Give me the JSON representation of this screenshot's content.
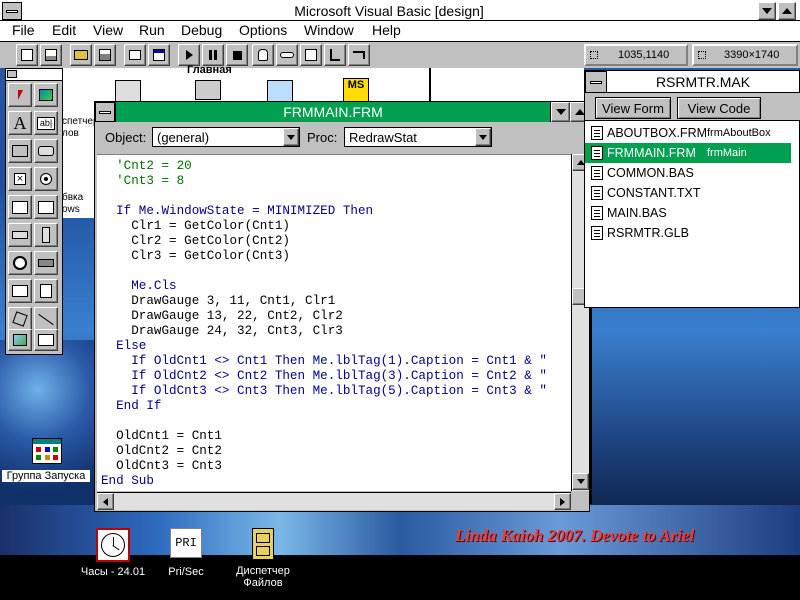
{
  "main_window": {
    "title": "Microsoft Visual Basic [design]",
    "menu": [
      "File",
      "Edit",
      "View",
      "Run",
      "Debug",
      "Options",
      "Window",
      "Help"
    ],
    "position_readout": "1035,1140",
    "size_readout": "3390×1740"
  },
  "code_window": {
    "title": "FRMMAIN.FRM",
    "object_label": "Object:",
    "object_value": "(general)",
    "proc_label": "Proc:",
    "proc_value": "RedrawStat",
    "lines": [
      "  'Cnt2 = 20",
      "  'Cnt3 = 8",
      "",
      "  If Me.WindowState = MINIMIZED Then",
      "    Clr1 = GetColor(Cnt1)",
      "    Clr2 = GetColor(Cnt2)",
      "    Clr3 = GetColor(Cnt3)",
      "",
      "    Me.Cls",
      "    DrawGauge 3, 11, Cnt1, Clr1",
      "    DrawGauge 13, 22, Cnt2, Clr2",
      "    DrawGauge 24, 32, Cnt3, Clr3",
      "  Else",
      "    If OldCnt1 <> Cnt1 Then Me.lblTag(1).Caption = Cnt1 & \"",
      "    If OldCnt2 <> Cnt2 Then Me.lblTag(3).Caption = Cnt2 & \"",
      "    If OldCnt3 <> Cnt3 Then Me.lblTag(5).Caption = Cnt3 & \"",
      "  End If",
      "",
      "  OldCnt1 = Cnt1",
      "  OldCnt2 = Cnt2",
      "  OldCnt3 = Cnt3",
      "End Sub"
    ]
  },
  "project_window": {
    "title": "RSRMTR.MAK",
    "view_form_label": "View Form",
    "view_code_label": "View Code",
    "files": [
      {
        "name": "ABOUTBOX.FRM",
        "module": "frmAboutBox",
        "selected": false
      },
      {
        "name": "FRMMAIN.FRM",
        "module": "frmMain",
        "selected": true
      },
      {
        "name": "COMMON.BAS",
        "module": "",
        "selected": false
      },
      {
        "name": "CONSTANT.TXT",
        "module": "",
        "selected": false
      },
      {
        "name": "MAIN.BAS",
        "module": "",
        "selected": false
      },
      {
        "name": "RSRMTR.GLB",
        "module": "",
        "selected": false
      }
    ]
  },
  "background_window": {
    "title_fragment": "Главная",
    "left_labels": [
      "спетчер",
      "лов",
      "бвка",
      "ows"
    ]
  },
  "desktop": {
    "group_label": "Группа Запуска",
    "banner": "Linda Kaioh 2007. Devote to Ariel",
    "taskbar_icons": [
      {
        "label": "Часы - 24.01",
        "icon": "clock-icon"
      },
      {
        "label": "Pri/Sec",
        "icon": "pri-icon",
        "text": "PRI"
      },
      {
        "label": "Диспетчер\nФайлов",
        "icon": "file-cabinet-icon"
      }
    ]
  },
  "colors": {
    "active_title": "#00a050",
    "inactive_title": "#ffffff",
    "selection": "#00a050",
    "comment": "#007000",
    "keyword": "#00008b",
    "banner": "#e84040"
  }
}
